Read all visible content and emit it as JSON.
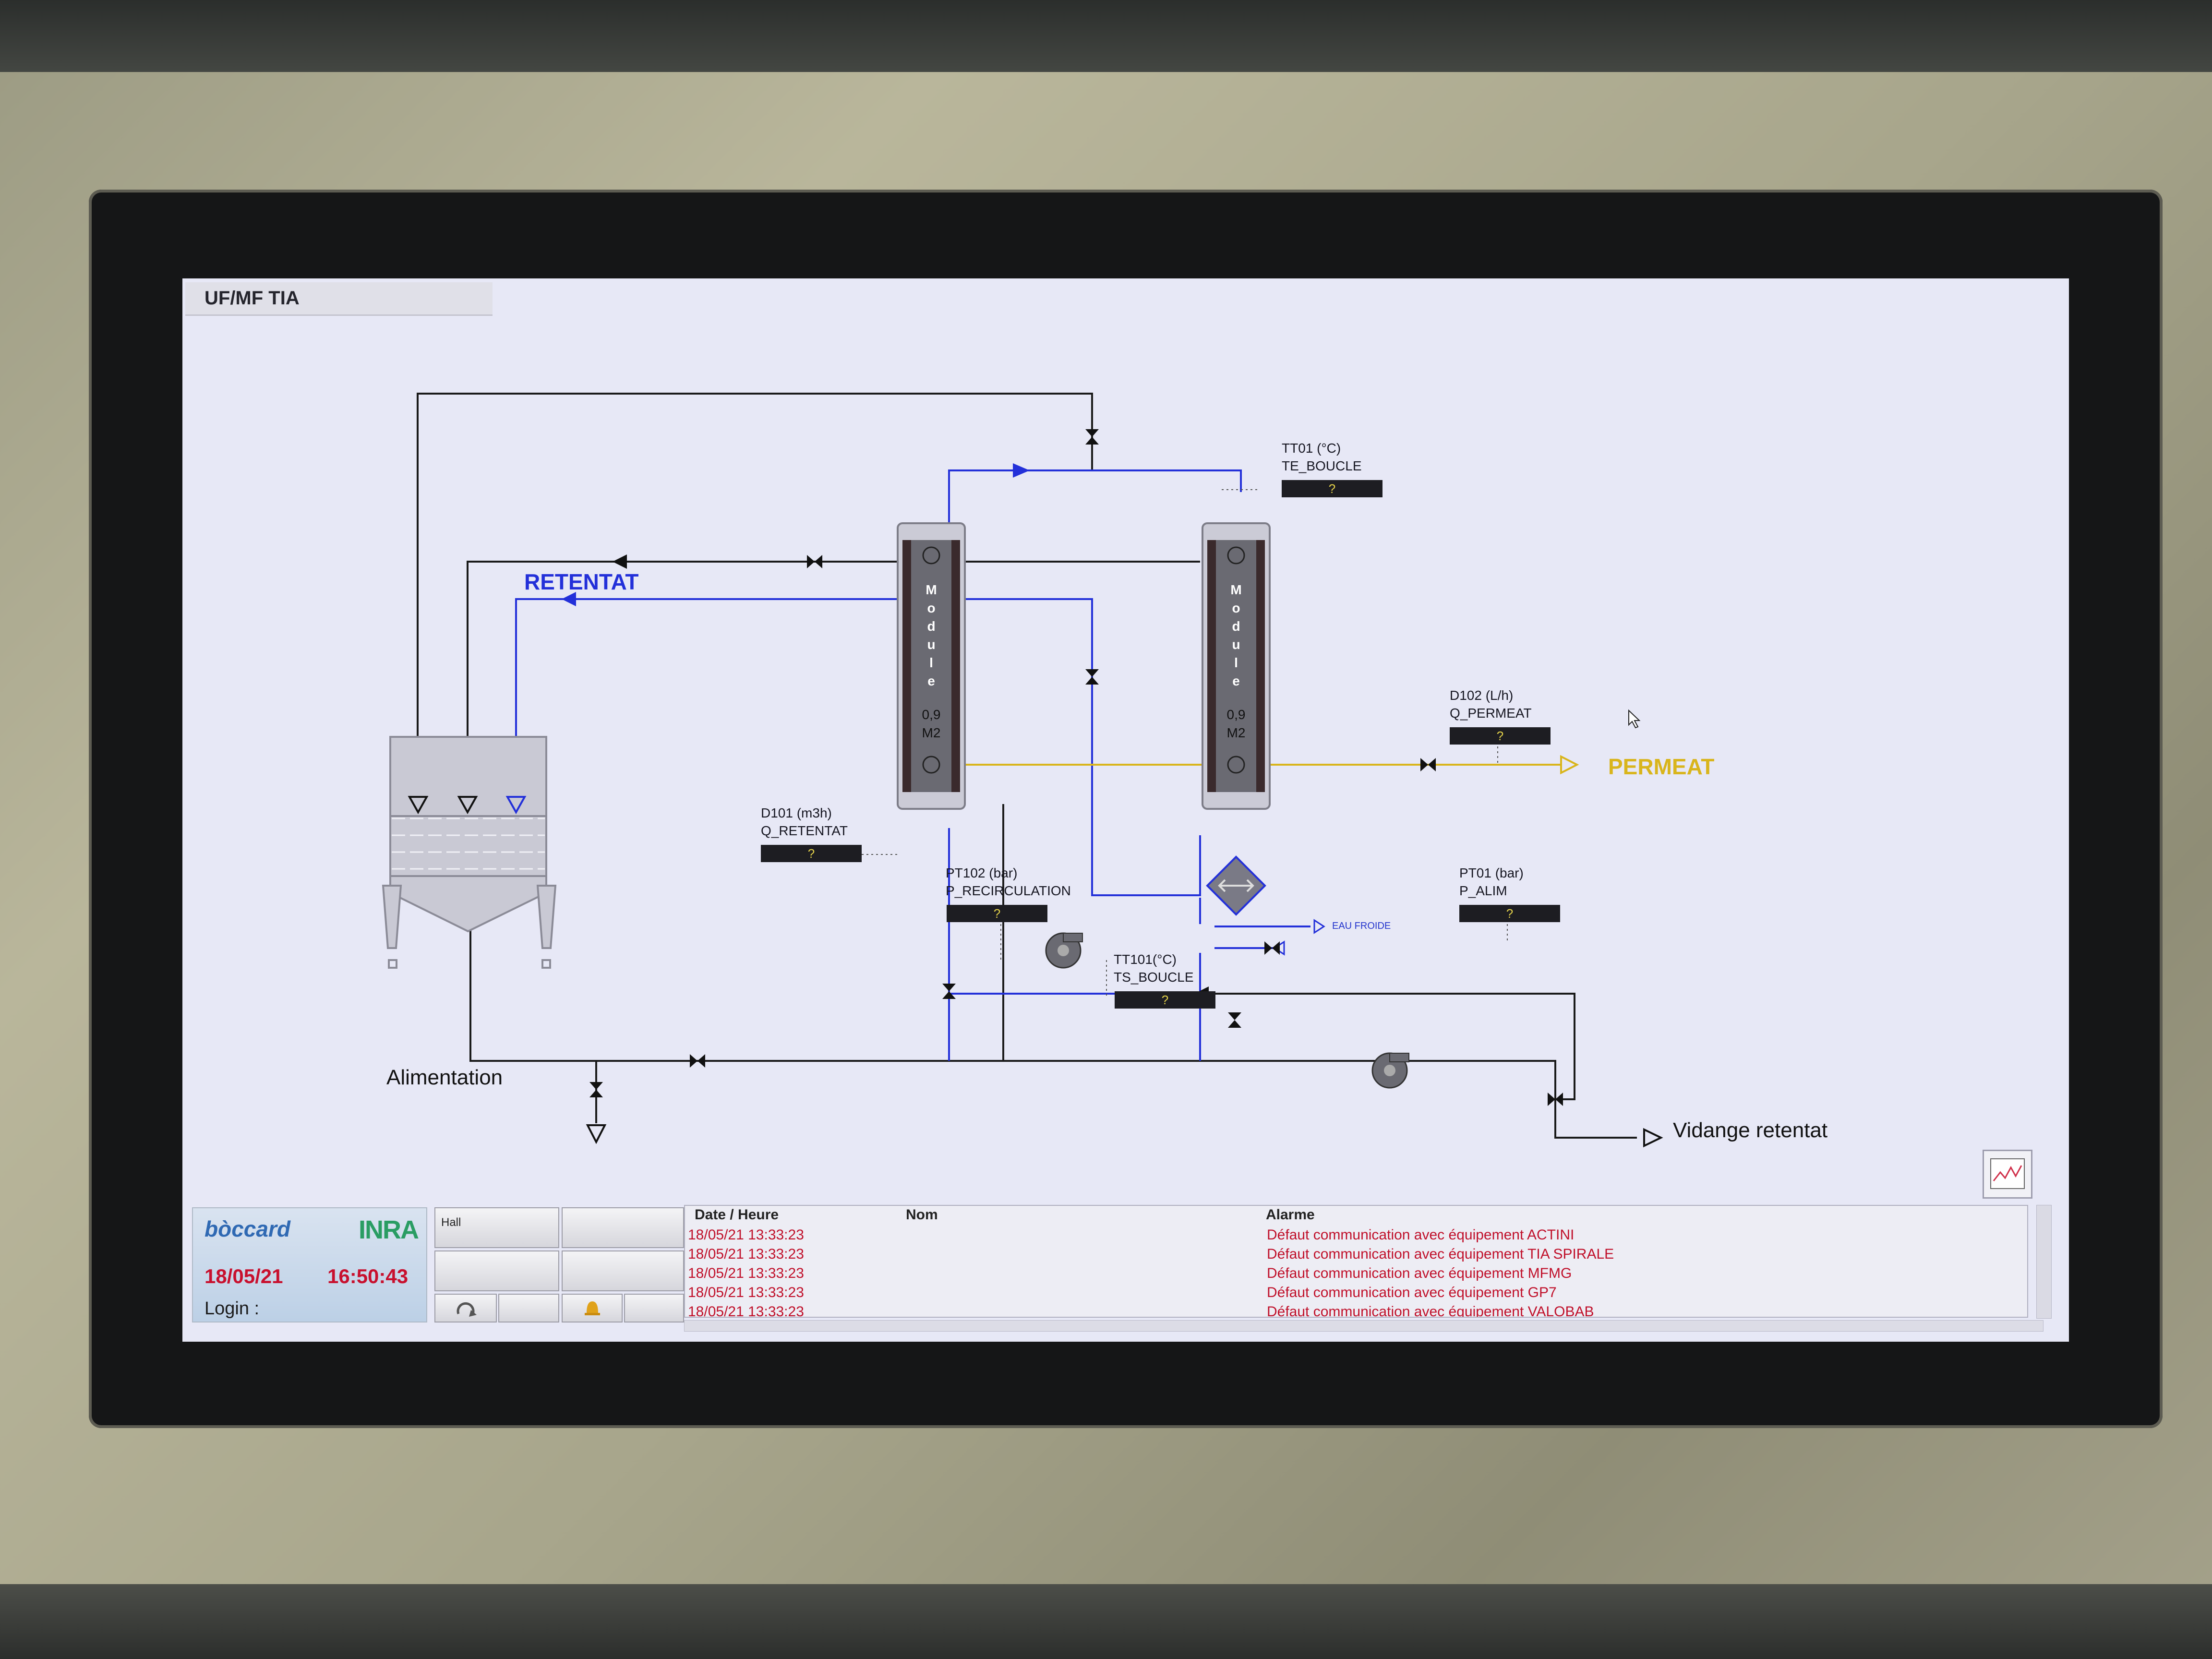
{
  "window": {
    "title": "UF/MF TIA"
  },
  "colors": {
    "screen_bg": "#e7e8f6",
    "retentat_blue": "#2330d9",
    "permeat_yellow": "#d9b51c",
    "pipe_black": "#1a1a1a",
    "alarm_red": "#c0102a",
    "datetime_red": "#c8102e"
  },
  "sensors": {
    "tt01": {
      "label1": "TT01 (°C)",
      "label2": "TE_BOUCLE",
      "value": "?"
    },
    "d102": {
      "label1": "D102 (L/h)",
      "label2": "Q_PERMEAT",
      "value": "?"
    },
    "d101": {
      "label1": "D101 (m3h)",
      "label2": "Q_RETENTAT",
      "value": "?"
    },
    "pt102": {
      "label1": "PT102 (bar)",
      "label2": "P_RECIRCULATION",
      "value": "?"
    },
    "pt01": {
      "label1": "PT01 (bar)",
      "label2": "P_ALIM",
      "value": "?"
    },
    "tt101": {
      "label1": "TT101(°C)",
      "label2": "TS_BOUCLE",
      "value": "?"
    }
  },
  "modules": [
    {
      "letters": [
        "M",
        "o",
        "d",
        "u",
        "l",
        "e"
      ],
      "size_line1": "0,9",
      "size_line2": "M2"
    },
    {
      "letters": [
        "M",
        "o",
        "d",
        "u",
        "l",
        "e"
      ],
      "size_line1": "0,9",
      "size_line2": "M2"
    }
  ],
  "labels": {
    "retentat": "RETENTAT",
    "permeat": "PERMEAT",
    "alimentation": "Alimentation",
    "vidange": "Vidange retentat",
    "eau_froide": "EAU FROIDE"
  },
  "icons": {
    "valve": "bowtie-valve-icon",
    "pump": "centrifugal-pump-icon",
    "heat_exchanger": "diamond-heat-exchanger-icon",
    "trend": "trend-chart-icon",
    "refresh": "refresh-icon",
    "bell": "alarm-bell-icon",
    "cursor": "mouse-pointer-icon"
  },
  "brand": {
    "boccard": "bòccard",
    "inra": "INRA",
    "date": "18/05/21",
    "time": "16:50:43",
    "login_label": "Login :"
  },
  "nav": {
    "hall_label": "Hall"
  },
  "alarms": {
    "columns": [
      "Date / Heure",
      "Nom",
      "Alarme"
    ],
    "rows": [
      {
        "datetime": "18/05/21 13:33:23",
        "name": "",
        "message": "Défaut communication avec équipement ACTINI"
      },
      {
        "datetime": "18/05/21 13:33:23",
        "name": "",
        "message": "Défaut communication avec équipement TIA SPIRALE"
      },
      {
        "datetime": "18/05/21 13:33:23",
        "name": "",
        "message": "Défaut communication avec équipement MFMG"
      },
      {
        "datetime": "18/05/21 13:33:23",
        "name": "",
        "message": "Défaut communication avec équipement GP7"
      },
      {
        "datetime": "18/05/21 13:33:23",
        "name": "",
        "message": "Défaut communication avec équipement VALOBAB"
      }
    ]
  }
}
